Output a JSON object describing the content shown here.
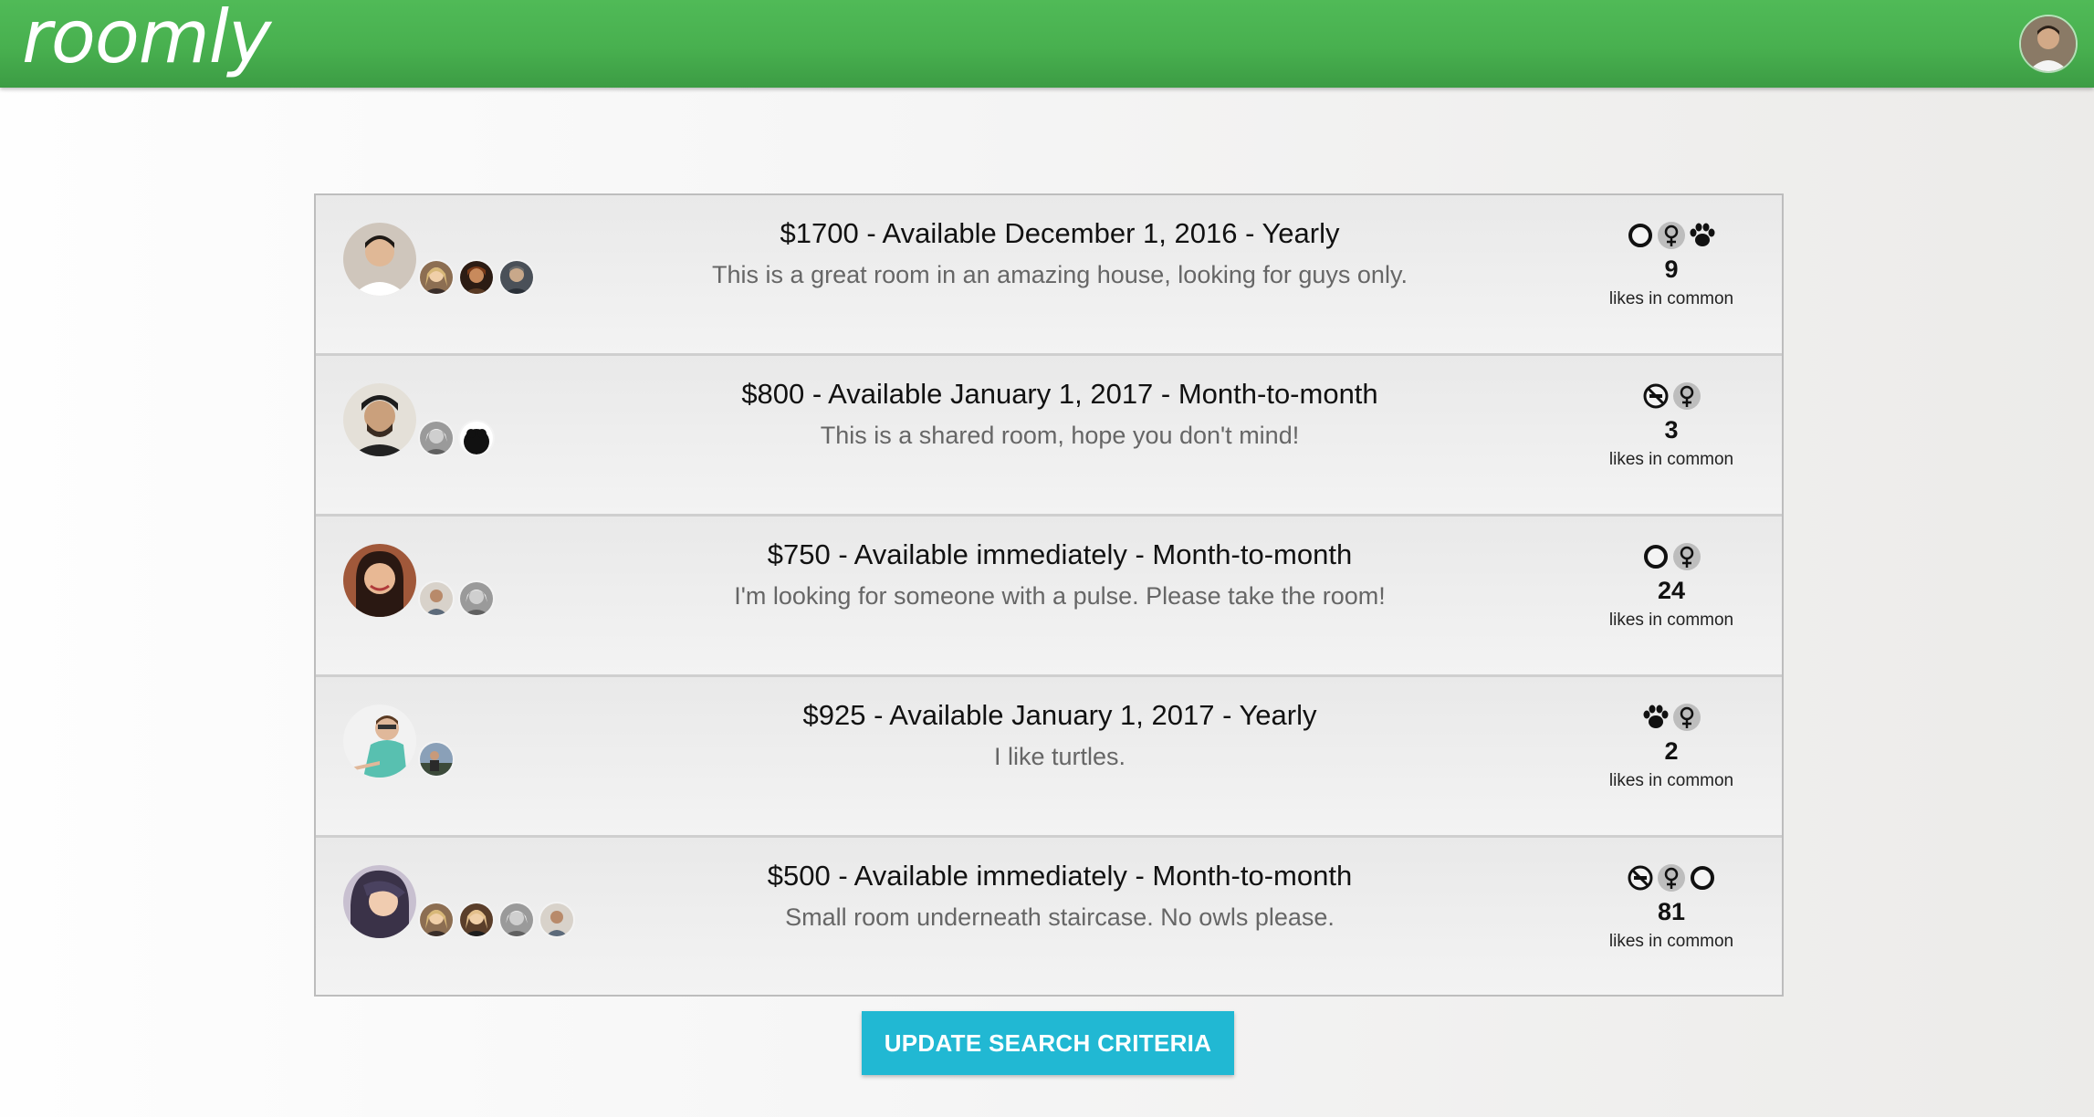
{
  "app": {
    "logo": "roomly"
  },
  "colors": {
    "brand_green": "#4cb653",
    "button_cyan": "#21b8d3"
  },
  "listings": [
    {
      "title": "$1700 - Available December 1, 2016 - Yearly",
      "description": "This is a great room in an amazing house, looking for guys only.",
      "preference_icons": [
        "male-icon",
        "female-icon",
        "paw-icon"
      ],
      "likes_count": "9",
      "likes_label": "likes in common",
      "roommate_count": 3
    },
    {
      "title": "$800 - Available January 1, 2017 - Month-to-month",
      "description": "This is a shared room, hope you don't mind!",
      "preference_icons": [
        "no-smoking-icon",
        "female-icon"
      ],
      "likes_count": "3",
      "likes_label": "likes in common",
      "roommate_count": 2
    },
    {
      "title": "$750 - Available immediately - Month-to-month",
      "description": "I'm looking for someone with a pulse. Please take the room!",
      "preference_icons": [
        "male-icon",
        "female-icon"
      ],
      "likes_count": "24",
      "likes_label": "likes in common",
      "roommate_count": 2
    },
    {
      "title": "$925 - Available January 1, 2017 - Yearly",
      "description": "I like turtles.",
      "preference_icons": [
        "paw-icon",
        "female-icon"
      ],
      "likes_count": "2",
      "likes_label": "likes in common",
      "roommate_count": 1
    },
    {
      "title": "$500 - Available immediately - Month-to-month",
      "description": "Small room underneath staircase. No owls please.",
      "preference_icons": [
        "no-smoking-icon",
        "female-icon",
        "male-icon"
      ],
      "likes_count": "81",
      "likes_label": "likes in common",
      "roommate_count": 4
    }
  ],
  "actions": {
    "update_label": "UPDATE SEARCH CRITERIA"
  }
}
